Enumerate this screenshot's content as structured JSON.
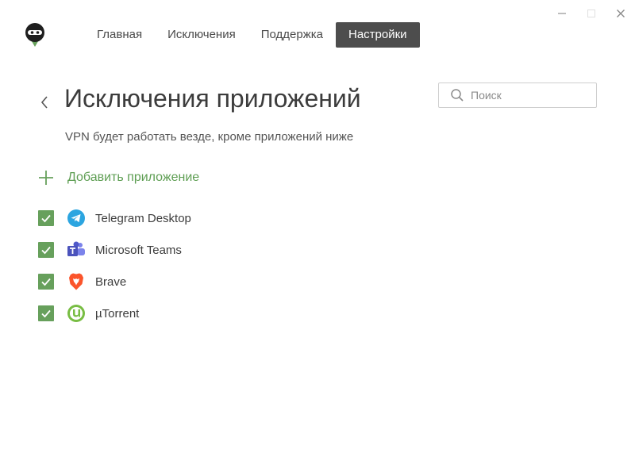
{
  "window": {
    "controls": [
      {
        "name": "minimize-button",
        "icon": "minimize-icon"
      },
      {
        "name": "maximize-button",
        "icon": "maximize-icon"
      },
      {
        "name": "close-button",
        "icon": "close-icon"
      }
    ]
  },
  "app": {
    "logo_icon": "ninja-shield-logo"
  },
  "nav": {
    "items": [
      {
        "label": "Главная"
      },
      {
        "label": "Исключения"
      },
      {
        "label": "Поддержка"
      },
      {
        "label": "Настройки",
        "active": true
      }
    ]
  },
  "page": {
    "title": "Исключения приложений",
    "subtitle": "VPN будет работать везде, кроме приложений ниже",
    "back_icon": "chevron-left-icon"
  },
  "search": {
    "placeholder": "Поиск",
    "value": "",
    "icon": "search-icon"
  },
  "add_app": {
    "label": "Добавить приложение",
    "icon": "plus-icon"
  },
  "apps": [
    {
      "name": "Telegram Desktop",
      "icon": "telegram-icon",
      "checked": true
    },
    {
      "name": "Microsoft Teams",
      "icon": "microsoft-teams-icon",
      "checked": true
    },
    {
      "name": "Brave",
      "icon": "brave-icon",
      "checked": true
    },
    {
      "name": "µTorrent",
      "icon": "utorrent-icon",
      "checked": true
    }
  ],
  "colors": {
    "accent_green": "#67a05c",
    "add_text_green": "#5e9e53",
    "active_tab_bg": "#4d4d4d",
    "active_tab_text": "#ffffff"
  }
}
